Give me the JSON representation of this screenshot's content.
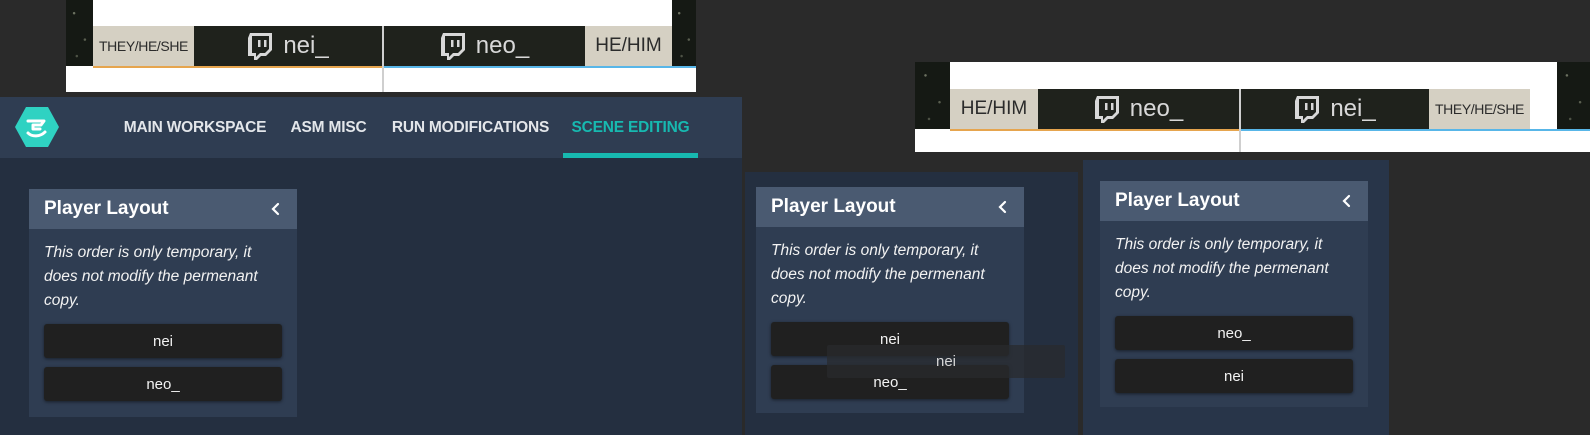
{
  "overlay_left": {
    "pronoun_left": "THEY/HE/SHE",
    "name_left": "nei_",
    "name_right": "neo_",
    "pronoun_right": "HE/HIM"
  },
  "overlay_right": {
    "pronoun_left": "HE/HIM",
    "name_left": "neo_",
    "name_right": "nei_",
    "pronoun_right": "THEY/HE/SHE"
  },
  "nav": {
    "tabs": [
      "MAIN WORKSPACE",
      "ASM MISC",
      "RUN MODIFICATIONS",
      "SCENE EDITING"
    ],
    "active": "SCENE EDITING"
  },
  "panels": [
    {
      "title": "Player Layout",
      "note": "This order is only temporary, it does not modify the permenant copy.",
      "buttons": [
        "nei",
        "neo_"
      ]
    },
    {
      "title": "Player Layout",
      "note": "This order is only temporary, it does not modify the permenant copy.",
      "buttons": [
        "nei",
        "neo_"
      ],
      "dragging": "nei"
    },
    {
      "title": "Player Layout",
      "note": "This order is only temporary, it does not modify the permenant copy.",
      "buttons": [
        "neo_",
        "nei"
      ]
    }
  ],
  "colors": {
    "accent": "#17b9b0",
    "header": "#2f3d52",
    "panel_head": "#4a5a71",
    "button": "#202020",
    "pronoun_bg": "#d5d0c3"
  },
  "icons": [
    "twitch-icon",
    "nodecg-logo",
    "chevron-left-icon"
  ]
}
